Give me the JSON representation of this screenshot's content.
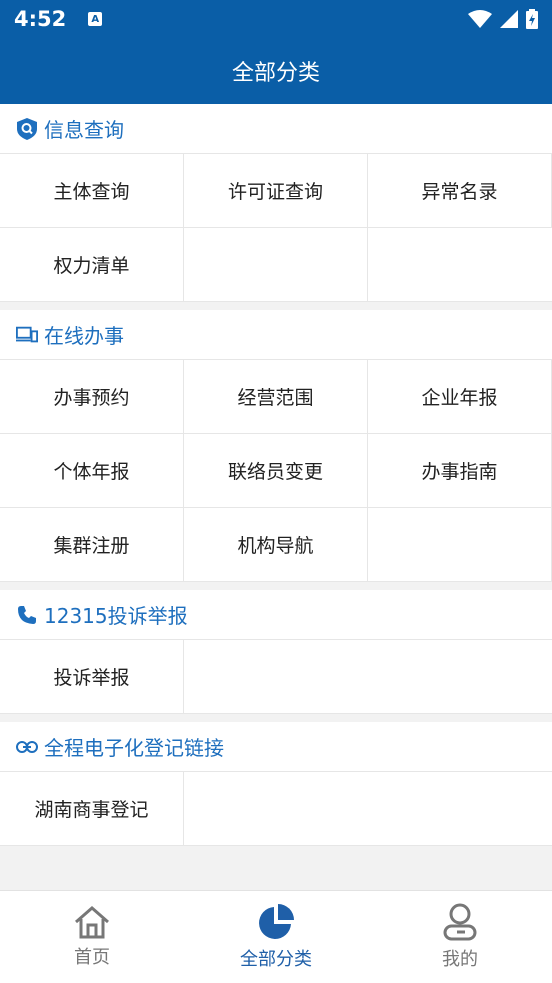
{
  "status": {
    "time": "4:52",
    "a_icon_letter": "A"
  },
  "app": {
    "title": "全部分类"
  },
  "sections": [
    {
      "title": "信息查询",
      "icon": "search-shield-icon",
      "items": [
        "主体查询",
        "许可证查询",
        "异常名录",
        "权力清单"
      ]
    },
    {
      "title": "在线办事",
      "icon": "devices-icon",
      "items": [
        "办事预约",
        "经营范围",
        "企业年报",
        "个体年报",
        "联络员变更",
        "办事指南",
        "集群注册",
        "机构导航"
      ]
    },
    {
      "title": "12315投诉举报",
      "icon": "phone-icon",
      "items": [
        "投诉举报"
      ]
    },
    {
      "title": "全程电子化登记链接",
      "icon": "link-icon",
      "items": [
        "湖南商事登记"
      ]
    }
  ],
  "nav": {
    "home": "首页",
    "categories": "全部分类",
    "mine": "我的"
  },
  "colors": {
    "primary": "#0a5ea7",
    "accent": "#1e6fbe",
    "nav_active": "#1f5fa8"
  }
}
